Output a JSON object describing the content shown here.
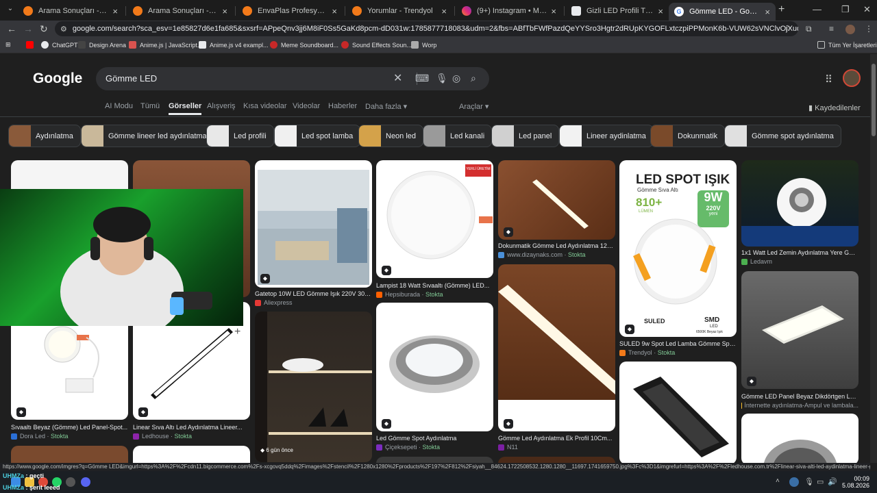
{
  "browser": {
    "tabs": [
      {
        "title": "Arama Sonuçları - Trendyol",
        "icon": "trendyol-icon",
        "active": false
      },
      {
        "title": "Arama Sonuçları - Trendyol",
        "icon": "trendyol-icon",
        "active": false
      },
      {
        "title": "EnvaPlas Profesyonel Bahçe Ek",
        "icon": "trendyol-icon",
        "active": false
      },
      {
        "title": "Yorumlar - Trendyol",
        "icon": "trendyol-icon",
        "active": false
      },
      {
        "title": "(9+) Instagram • Mesajlar",
        "icon": "instagram-icon",
        "active": false
      },
      {
        "title": "Gizli LED Profili Türkiye",
        "icon": "page-icon",
        "active": false
      },
      {
        "title": "Gömme LED - Google'da Ara",
        "icon": "google-icon",
        "active": true
      }
    ],
    "url": "google.com/search?sca_esv=1e85827d6e1fa685&sxsrf=APpeQnv3jj6M8iF0Ss5GaKd8pcm-dD031w:1785877718083&udm=2&fbs=ABfTbFWfPazdQeYYSro3Hgtr2dRUpKYGOFLxtczpiPPMonK6b-VUW62sVNClvOjXudyfFYR694_9bZqivV4Zt5kdHrm-tv5O...",
    "bookmarks": [
      {
        "label": "",
        "color": "#ff0000"
      },
      {
        "label": "ChatGPT",
        "color": "#e8eaed"
      },
      {
        "label": "Design Arena",
        "color": "#444"
      },
      {
        "label": "Anime.js | JavaScript...",
        "color": "#d9534f"
      },
      {
        "label": "Anime.js v4 exampl...",
        "color": "#e8eaed"
      },
      {
        "label": "Meme Soundboard...",
        "color": "#c62828"
      },
      {
        "label": "Sound Effects Soun...",
        "color": "#c62828"
      },
      {
        "label": "Worp",
        "color": "#aaa"
      }
    ],
    "other_bookmarks": "Tüm Yer İşaretleri"
  },
  "google": {
    "logo": "Google",
    "query": "Gömme LED",
    "tabs": [
      "AI Modu",
      "Tümü",
      "Görseller",
      "Alışveriş",
      "Kısa videolar",
      "Videolar",
      "Haberler",
      "Daha fazla"
    ],
    "active_tab": "Görseller",
    "tools": "Araçlar",
    "saved": "Kaydedilenler",
    "chips": [
      {
        "label": "Aydınlatma",
        "color": "#8a5a3a"
      },
      {
        "label": "Gömme lineer led aydınlatma",
        "color": "#c9b89a"
      },
      {
        "label": "Led profili",
        "color": "#e8e8e8"
      },
      {
        "label": "Led spot lamba",
        "color": "#f0f0f0"
      },
      {
        "label": "Neon led",
        "color": "#d4a24a"
      },
      {
        "label": "Led kanali",
        "color": "#9a9a9a"
      },
      {
        "label": "Led panel",
        "color": "#d0d0d0"
      },
      {
        "label": "Lineer aydinlatma",
        "color": "#f2f2f2"
      },
      {
        "label": "Dokunmatik",
        "color": "#7a4a2a"
      },
      {
        "label": "Gömme spot aydınlatma",
        "color": "#e0e0e0"
      }
    ],
    "results": [
      {
        "title": "",
        "source": "",
        "stock": "",
        "bg": "#f5f5f5",
        "fav": "#fff"
      },
      {
        "title": "",
        "source": "",
        "stock": "",
        "bg": "#8a5538",
        "fav": "#fff"
      },
      {
        "title": "Sıvaaltı Beyaz (Gömme) Led Panel-Spot...",
        "source": "Dora Led",
        "stock": "Stokta",
        "bg": "#ffffff",
        "fav": "#2a6fd6"
      },
      {
        "title": "Linear Sıva Altı Led Aydınlatma Lineer...",
        "source": "Ledhouse",
        "stock": "Stokta",
        "bg": "#ffffff",
        "fav": "#8e24aa"
      },
      {
        "title": "Gatetop 10W LED Gömme Işık 220V 3000K",
        "source": "Aliexpress",
        "stock": "",
        "bg": "#d9d2c4",
        "fav": "#e53935"
      },
      {
        "title": "",
        "source": "",
        "stock": "",
        "bg": "#2a2622",
        "fav": "#fff",
        "badge": "6 gün önce"
      },
      {
        "title": "Lampist 18 Watt Sıvaaltı (Gömme) LED...",
        "source": "Hepsiburada",
        "stock": "Stokta",
        "bg": "#ffffff",
        "fav": "#ff6000"
      },
      {
        "title": "Led Gömme Spot Aydınlatma",
        "source": "Çiçeksepeti",
        "stock": "Stokta",
        "bg": "#ffffff",
        "fav": "#7b2cbf"
      },
      {
        "title": "Dokunmatik Gömme Led Aydınlatma 120 C...",
        "source": "www.dizaynaks.com",
        "stock": "Stokta",
        "bg": "#7a4526",
        "fav": "#4a90d9"
      },
      {
        "title": "Gömme Led Aydınlatma Ek Profil 10Cm...",
        "source": "N11",
        "stock": "",
        "bg": "#6d3e22",
        "fav": "#7b1fa2"
      },
      {
        "title": "SULED 9w Spot Led Lamba Gömme Spot...",
        "source": "Trendyol",
        "stock": "Stokta",
        "bg": "#ffffff",
        "fav": "#f27a1a"
      },
      {
        "title": "",
        "source": "",
        "stock": "",
        "bg": "#ffffff",
        "fav": "#fff"
      },
      {
        "title": "1x1 Watt Led Zemin Aydınlatma Yere Göm...",
        "source": "Ledavm",
        "stock": "",
        "bg": "#1e2a1a",
        "fav": "#4caf50"
      },
      {
        "title": "Gömme LED Panel Beyaz Dikdörtgen LED...",
        "source": "İnternette aydınlatma-Ampul ve lambala...",
        "stock": "",
        "bg": "#555555",
        "fav": "#fbc02d"
      },
      {
        "title": "",
        "source": "",
        "stock": "",
        "bg": "#ffffff",
        "fav": "#fff"
      }
    ],
    "ad_texts": {
      "led_spot": "LED SPOT IŞIK",
      "subtitle": "Gömme Sıva Altı",
      "watt": "9W",
      "volt": "220V",
      "lumen": "810+",
      "lumen_unit": "LÜMEN",
      "new": "yeni",
      "brand": "SULED",
      "tech": "SMD",
      "tech_sub": "LED",
      "kelvin": "6500K Beyaz Işık",
      "yerli": "YERLİ ÜRETİM"
    }
  },
  "status_url": "https://www.google.com/imgres?q=Gömme LED&imgurl=https%3A%2F%2Fcdn11.bigcommerce.com%2Fs-xcgovq5ddq%2Fimages%2Fstencil%2F1280x1280%2Fproducts%2F197%2F812%2Fsiyah__84624.1722508532.1280.1280__11697.1741659750.jpg%3Fc%3D1&imgrefurl=https%3A%2F%2Fledhouse.com.tr%2Flinear-siva-alti-led-aydinlatma-lineer-go...",
  "taskbar": {
    "chat": [
      {
        "user": "UHMZa",
        "msg": "geçti"
      },
      {
        "user": "UHMZa",
        "msg": "şerit leeed"
      }
    ],
    "time": "00:09",
    "date": "5.08.2026"
  }
}
